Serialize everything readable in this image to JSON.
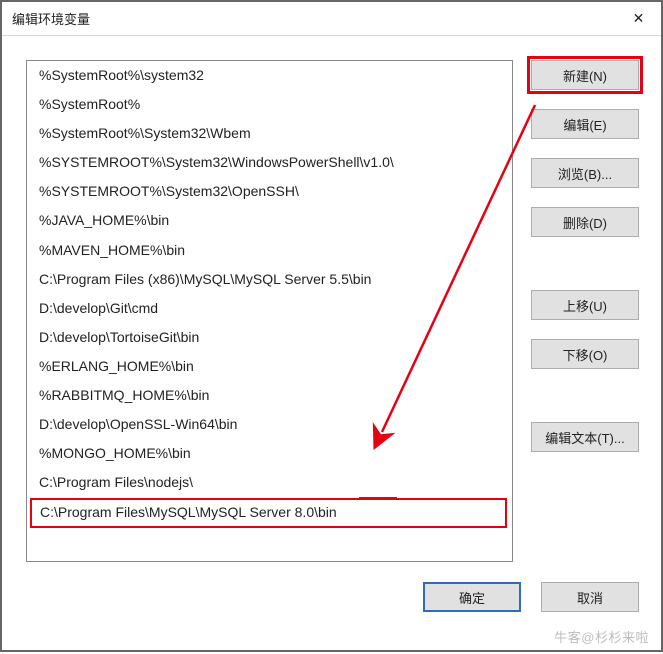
{
  "title": "编辑环境变量",
  "close_glyph": "✕",
  "list": {
    "items": [
      "%SystemRoot%\\system32",
      "%SystemRoot%",
      "%SystemRoot%\\System32\\Wbem",
      "%SYSTEMROOT%\\System32\\WindowsPowerShell\\v1.0\\",
      "%SYSTEMROOT%\\System32\\OpenSSH\\",
      "%JAVA_HOME%\\bin",
      "%MAVEN_HOME%\\bin",
      "C:\\Program Files (x86)\\MySQL\\MySQL Server 5.5\\bin",
      "D:\\develop\\Git\\cmd",
      "D:\\develop\\TortoiseGit\\bin",
      "%ERLANG_HOME%\\bin",
      "%RABBITMQ_HOME%\\bin",
      "D:\\develop\\OpenSSL-Win64\\bin",
      "%MONGO_HOME%\\bin",
      "C:\\Program Files\\nodejs\\",
      "C:\\Program Files\\MySQL\\MySQL Server 8.0\\bin"
    ],
    "highlight_index": 15
  },
  "buttons": {
    "new": "新建(N)",
    "edit": "编辑(E)",
    "browse": "浏览(B)...",
    "delete": "删除(D)",
    "moveup": "上移(U)",
    "movedown": "下移(O)",
    "edittext": "编辑文本(T)...",
    "ok": "确定",
    "cancel": "取消"
  },
  "annotation": {
    "highlighted_button": "新建(N)",
    "highlighted_item": "C:\\Program Files\\MySQL\\MySQL Server 8.0\\bin"
  },
  "watermark": "牛客@杉杉来啦"
}
